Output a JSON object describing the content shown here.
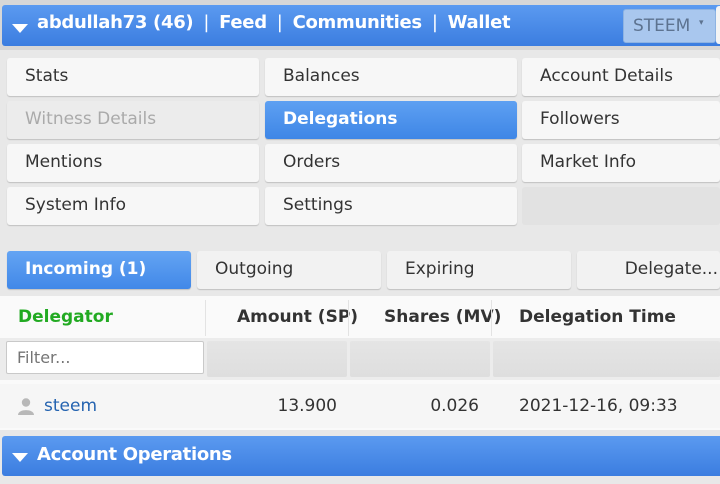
{
  "topbar": {
    "user": "abdullah73 (46)",
    "links": [
      "Feed",
      "Communities",
      "Wallet"
    ],
    "separator": "|",
    "currency": "STEEM",
    "caret": "▾"
  },
  "menu": {
    "items": [
      {
        "label": "Stats",
        "state": "normal"
      },
      {
        "label": "Balances",
        "state": "normal"
      },
      {
        "label": "Account Details",
        "state": "normal"
      },
      {
        "label": "Witness Details",
        "state": "disabled"
      },
      {
        "label": "Delegations",
        "state": "active"
      },
      {
        "label": "Followers",
        "state": "normal"
      },
      {
        "label": "Mentions",
        "state": "normal"
      },
      {
        "label": "Orders",
        "state": "normal"
      },
      {
        "label": "Market Info",
        "state": "normal"
      },
      {
        "label": "System Info",
        "state": "normal"
      },
      {
        "label": "Settings",
        "state": "normal"
      }
    ]
  },
  "tabs": [
    {
      "label": "Incoming (1)",
      "active": true
    },
    {
      "label": "Outgoing",
      "active": false
    },
    {
      "label": "Expiring",
      "active": false
    },
    {
      "label": "Delegate...",
      "active": false
    }
  ],
  "table": {
    "headers": {
      "delegator": "Delegator",
      "amount": "Amount (SP)",
      "shares": "Shares (MV)",
      "time": "Delegation Time"
    },
    "filter_placeholder": "Filter...",
    "rows": [
      {
        "delegator": "steem",
        "amount": "13.900",
        "shares": "0.026",
        "time": "2021-12-16, 09:33"
      }
    ]
  },
  "account_operations": {
    "label": "Account Operations"
  },
  "colors": {
    "accent": "#3b7de0",
    "green": "#22aa22",
    "link": "#2463b0"
  }
}
